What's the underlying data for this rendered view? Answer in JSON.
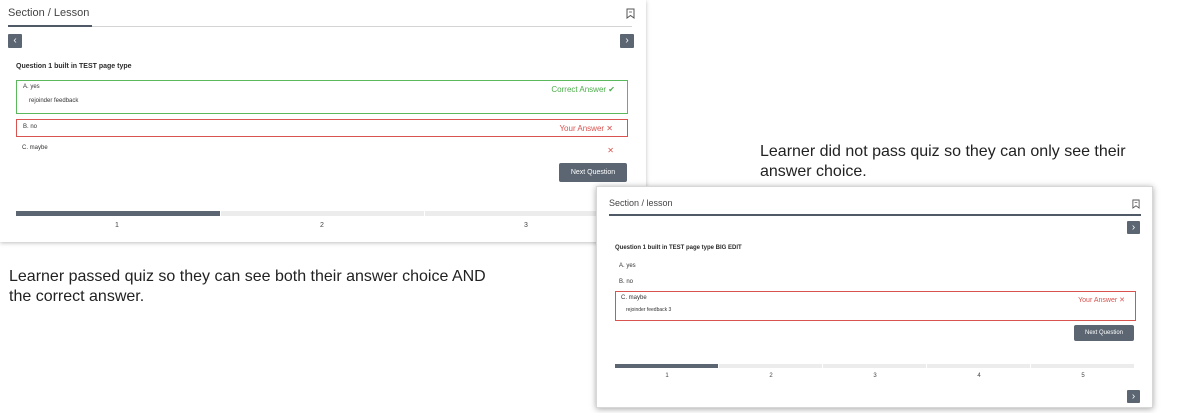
{
  "panel_passed": {
    "header_title": "Section / Lesson",
    "prev_symbol": "‹",
    "next_symbol": "›",
    "question_title": "Question 1 built in TEST page type",
    "options": [
      {
        "label": "A. yes",
        "feedback": "rejoinder feedback",
        "status": "Correct Answer ✔"
      },
      {
        "label": "B. no",
        "status": "Your Answer ✕"
      },
      {
        "label": "C. maybe",
        "status": "✕"
      }
    ],
    "next_button": "Next Question",
    "steps": [
      "1",
      "2",
      "3"
    ],
    "progress_active_index": 0
  },
  "panel_failed": {
    "header_title": "Section / lesson",
    "next_symbol": "›",
    "question_title": "Question 1 built in TEST page type BIG EDIT",
    "options": [
      {
        "label": "A. yes"
      },
      {
        "label": "B. no"
      },
      {
        "label": "C. maybe",
        "feedback": "rejoinder feedback 3",
        "status": "Your Answer ✕"
      }
    ],
    "next_button": "Next Question",
    "steps": [
      "1",
      "2",
      "3",
      "4",
      "5"
    ],
    "progress_active_index": 0
  },
  "captions": {
    "passed": "Learner passed quiz so they can see both their answer choice AND the correct answer.",
    "failed": "Learner did not pass quiz so they can only see their answer choice."
  },
  "colors": {
    "correct": "#4cae4c",
    "wrong": "#d9534f",
    "button": "#5b6672"
  }
}
